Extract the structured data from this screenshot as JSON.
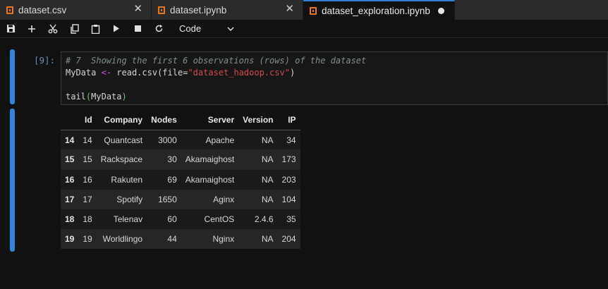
{
  "tabs": [
    {
      "label": "dataset.csv",
      "active": false
    },
    {
      "label": "dataset.ipynb",
      "active": false
    },
    {
      "label": "dataset_exploration.ipynb",
      "active": true
    }
  ],
  "toolbar": {
    "buttons": [
      "save-icon",
      "plus-icon",
      "cut-icon",
      "copy-icon",
      "paste-icon",
      "run-icon",
      "stop-icon",
      "restart-icon"
    ],
    "cell_type": "Code"
  },
  "cell": {
    "prompt": "[9]:",
    "code": {
      "comment": "# 7  Showing the first 6 observations (rows) of the dataset",
      "line2_var": "MyData",
      "line2_op": "<-",
      "line2_fn": "read.csv(file=",
      "line2_str": "\"dataset_hadoop.csv\"",
      "line2_end": ")",
      "line4_fn": "tail",
      "line4_open": "(",
      "line4_arg": "MyData",
      "line4_close": ")"
    }
  },
  "output_table": {
    "columns": [
      "",
      "Id",
      "Company",
      "Nodes",
      "Server",
      "Version",
      "IP"
    ],
    "rows": [
      [
        "14",
        "14",
        "Quantcast",
        "3000",
        "Apache",
        "NA",
        "34"
      ],
      [
        "15",
        "15",
        "Rackspace",
        "30",
        "Akamaighost",
        "NA",
        "173"
      ],
      [
        "16",
        "16",
        "Rakuten",
        "69",
        "Akamaighost",
        "NA",
        "203"
      ],
      [
        "17",
        "17",
        "Spotify",
        "1650",
        "Aginx",
        "NA",
        "104"
      ],
      [
        "18",
        "18",
        "Telenav",
        "60",
        "CentOS",
        "2.4.6",
        "35"
      ],
      [
        "19",
        "19",
        "Worldlingo",
        "44",
        "Nginx",
        "NA",
        "204"
      ]
    ]
  },
  "colors": {
    "accent": "#2f86d8",
    "notebook_icon": "#e8771f",
    "background": "#111111"
  }
}
